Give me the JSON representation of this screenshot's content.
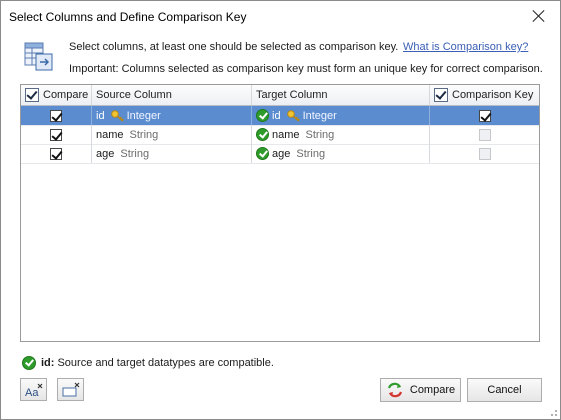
{
  "window": {
    "title": "Select Columns and Define Comparison Key"
  },
  "info": {
    "line1": "Select columns, at least one should be selected as comparison key.",
    "help_link": "What is Comparison key?",
    "line2": "Important: Columns selected as comparison key must form an unique key for correct comparison."
  },
  "grid": {
    "headers": {
      "compare": "Compare",
      "source": "Source Column",
      "target": "Target Column",
      "key": "Comparison Key"
    },
    "rows": [
      {
        "compare": true,
        "source_name": "id",
        "source_type": "Integer",
        "source_key": true,
        "target_name": "id",
        "target_type": "Integer",
        "target_key": true,
        "target_ok": true,
        "comparison_key": true,
        "selected": true
      },
      {
        "compare": true,
        "source_name": "name",
        "source_type": "String",
        "source_key": false,
        "target_name": "name",
        "target_type": "String",
        "target_key": false,
        "target_ok": true,
        "comparison_key": false,
        "selected": false
      },
      {
        "compare": true,
        "source_name": "age",
        "source_type": "String",
        "source_key": false,
        "target_name": "age",
        "target_type": "String",
        "target_key": false,
        "target_ok": true,
        "comparison_key": false,
        "selected": false
      }
    ]
  },
  "status": {
    "column": "id:",
    "message": "Source and target datatypes are compatible."
  },
  "buttons": {
    "compare": "Compare",
    "cancel": "Cancel"
  },
  "icons": {
    "close": "close-icon",
    "header": "columns-table-icon",
    "key": "key-icon",
    "ok": "check-circle-icon",
    "case": "case-sensitivity-icon",
    "clear": "clear-icon",
    "compare": "compare-arrows-icon"
  },
  "colors": {
    "selection": "#5b8cd0",
    "ok_green": "#2f9b2b",
    "key_gold": "#e7b626",
    "link": "#3a5fb5"
  }
}
